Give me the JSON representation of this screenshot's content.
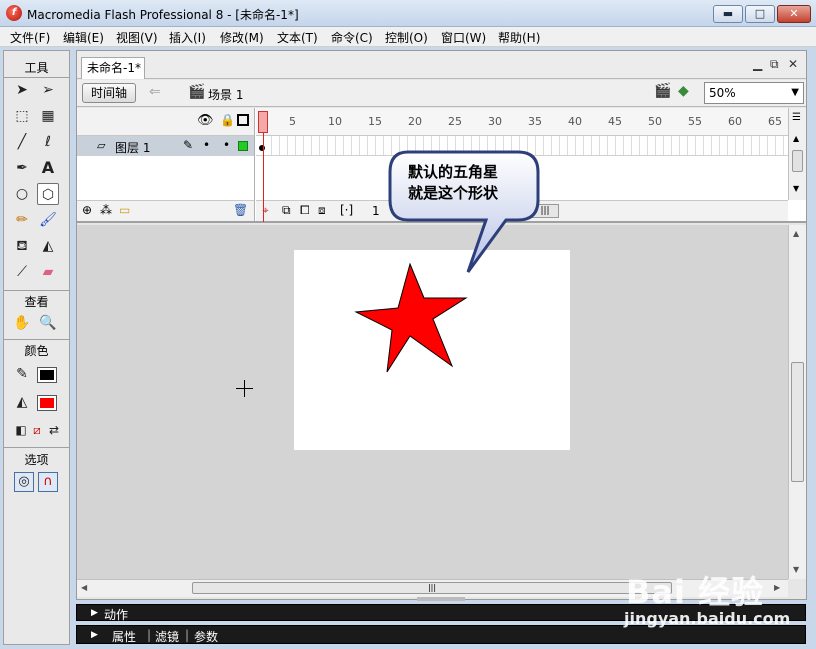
{
  "window": {
    "title": "Macromedia Flash Professional 8 - [未命名-1*]",
    "minimize_glyph": "▬",
    "maximize_glyph": "□",
    "close_glyph": "✕"
  },
  "menu": [
    "文件(F)",
    "编辑(E)",
    "视图(V)",
    "插入(I)",
    "修改(M)",
    "文本(T)",
    "命令(C)",
    "控制(O)",
    "窗口(W)",
    "帮助(H)"
  ],
  "toolbox": {
    "title": "工具",
    "view_label": "查看",
    "color_label": "颜色",
    "options_label": "选项",
    "stroke_color": "#000000",
    "fill_color": "#ff0000"
  },
  "document": {
    "tab_label": "未命名-1*",
    "timeline_button": "时间轴",
    "scene_label": "场景 1",
    "zoom_value": "50%",
    "current_frame": "1"
  },
  "timeline": {
    "layer_name": "图层 1",
    "ruler_ticks": [
      "1",
      "5",
      "10",
      "15",
      "20",
      "25",
      "30",
      "35",
      "40",
      "45",
      "50",
      "55",
      "60",
      "65"
    ],
    "layer_outline_color": "#22cc22"
  },
  "stage": {
    "shape_fill": "#ff0000",
    "shape_stroke": "#000000"
  },
  "callout": {
    "line1": "默认的五角星",
    "line2": "就是这个形状"
  },
  "panels": {
    "actions_label": "动作",
    "tab_properties": "属性",
    "tab_filters": "滤镜",
    "tab_params": "参数"
  },
  "watermark": {
    "logo": "Bai 经验",
    "url": "jingyan.baidu.com"
  }
}
